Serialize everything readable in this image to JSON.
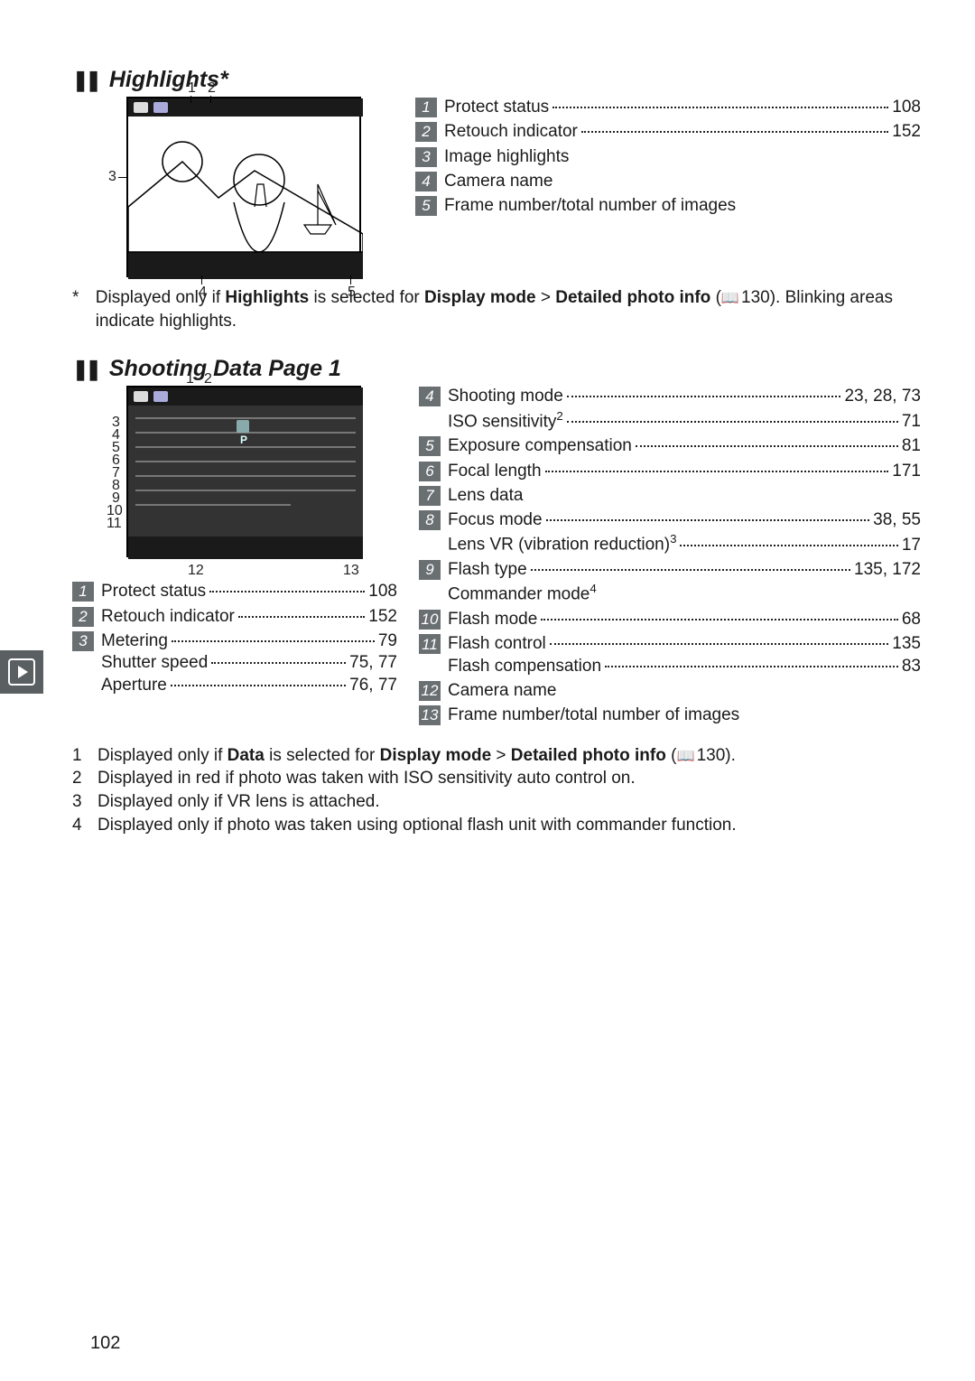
{
  "page_number": "102",
  "sections": {
    "highlights": {
      "title": "Highlights*",
      "legend": [
        {
          "n": "1",
          "items": [
            {
              "label": "Protect status",
              "page": "108"
            }
          ]
        },
        {
          "n": "2",
          "items": [
            {
              "label": "Retouch indicator",
              "page": "152"
            }
          ]
        },
        {
          "n": "3",
          "items": [
            {
              "label": "Image highlights",
              "page": ""
            }
          ]
        },
        {
          "n": "4",
          "items": [
            {
              "label": "Camera name",
              "page": ""
            }
          ]
        },
        {
          "n": "5",
          "items": [
            {
              "label": "Frame number/total number of images",
              "page": ""
            }
          ]
        }
      ],
      "footnote": {
        "mark": "*",
        "before": "Displayed only if ",
        "b1": "Highlights",
        "mid1": " is selected for ",
        "b2": "Display mode",
        "gt": " > ",
        "b3": "Detailed photo info",
        "open": " (",
        "ref": "130",
        "after": "). Blinking areas indicate highlights."
      },
      "diagram_callouts": {
        "c1": "1",
        "c2": "2",
        "c3": "3",
        "c4": "4",
        "c5": "5"
      }
    },
    "shooting": {
      "title": "Shooting Data Page 1",
      "legend_left": [
        {
          "n": "1",
          "items": [
            {
              "label": "Protect status",
              "page": "108"
            }
          ]
        },
        {
          "n": "2",
          "items": [
            {
              "label": "Retouch indicator",
              "page": "152"
            }
          ]
        },
        {
          "n": "3",
          "items": [
            {
              "label": "Metering",
              "page": "79"
            },
            {
              "label": "Shutter speed",
              "page": "75, 77"
            },
            {
              "label": "Aperture",
              "page": "76, 77"
            }
          ]
        }
      ],
      "legend_right": [
        {
          "n": "4",
          "items": [
            {
              "label": "Shooting mode",
              "page": "23, 28, 73"
            },
            {
              "label": "ISO sensitivity",
              "sup": "2",
              "page": "71"
            }
          ]
        },
        {
          "n": "5",
          "items": [
            {
              "label": "Exposure compensation",
              "page": "81"
            }
          ]
        },
        {
          "n": "6",
          "items": [
            {
              "label": "Focal length",
              "page": "171"
            }
          ]
        },
        {
          "n": "7",
          "items": [
            {
              "label": "Lens data",
              "page": ""
            }
          ]
        },
        {
          "n": "8",
          "items": [
            {
              "label": "Focus mode",
              "page": "38, 55"
            },
            {
              "label": "Lens VR (vibration reduction)",
              "sup": "3",
              "page": "17"
            }
          ]
        },
        {
          "n": "9",
          "items": [
            {
              "label": "Flash type",
              "page": "135, 172"
            },
            {
              "label": "Commander mode",
              "sup": "4",
              "page": ""
            }
          ]
        },
        {
          "n": "10",
          "items": [
            {
              "label": "Flash mode",
              "page": "68"
            }
          ]
        },
        {
          "n": "11",
          "items": [
            {
              "label": "Flash control",
              "page": "135"
            },
            {
              "label": "Flash compensation",
              "page": "83"
            }
          ]
        },
        {
          "n": "12",
          "items": [
            {
              "label": "Camera name",
              "page": ""
            }
          ]
        },
        {
          "n": "13",
          "items": [
            {
              "label": "Frame number/total number of images",
              "page": ""
            }
          ]
        }
      ],
      "footnotes": [
        {
          "mark": "1",
          "pre": "Displayed only if ",
          "b1": "Data",
          "mid1": " is selected for ",
          "b2": "Display mode",
          "gt": " > ",
          "b3": "Detailed photo info",
          "open": " (",
          "ref": "130",
          "after": ")."
        },
        {
          "mark": "2",
          "text": "Displayed in red if photo was taken with ISO sensitivity auto control on."
        },
        {
          "mark": "3",
          "text": "Displayed only if VR lens is attached."
        },
        {
          "mark": "4",
          "text": "Displayed only if photo was taken using optional flash unit with commander function."
        }
      ],
      "diagram_callouts": {
        "c1": "1",
        "c2": "2",
        "c3": "3",
        "c4": "4",
        "c5": "5",
        "c6": "6",
        "c7": "7",
        "c8": "8",
        "c9": "9",
        "c10": "10",
        "c11": "11",
        "c12": "12",
        "c13": "13"
      }
    }
  }
}
